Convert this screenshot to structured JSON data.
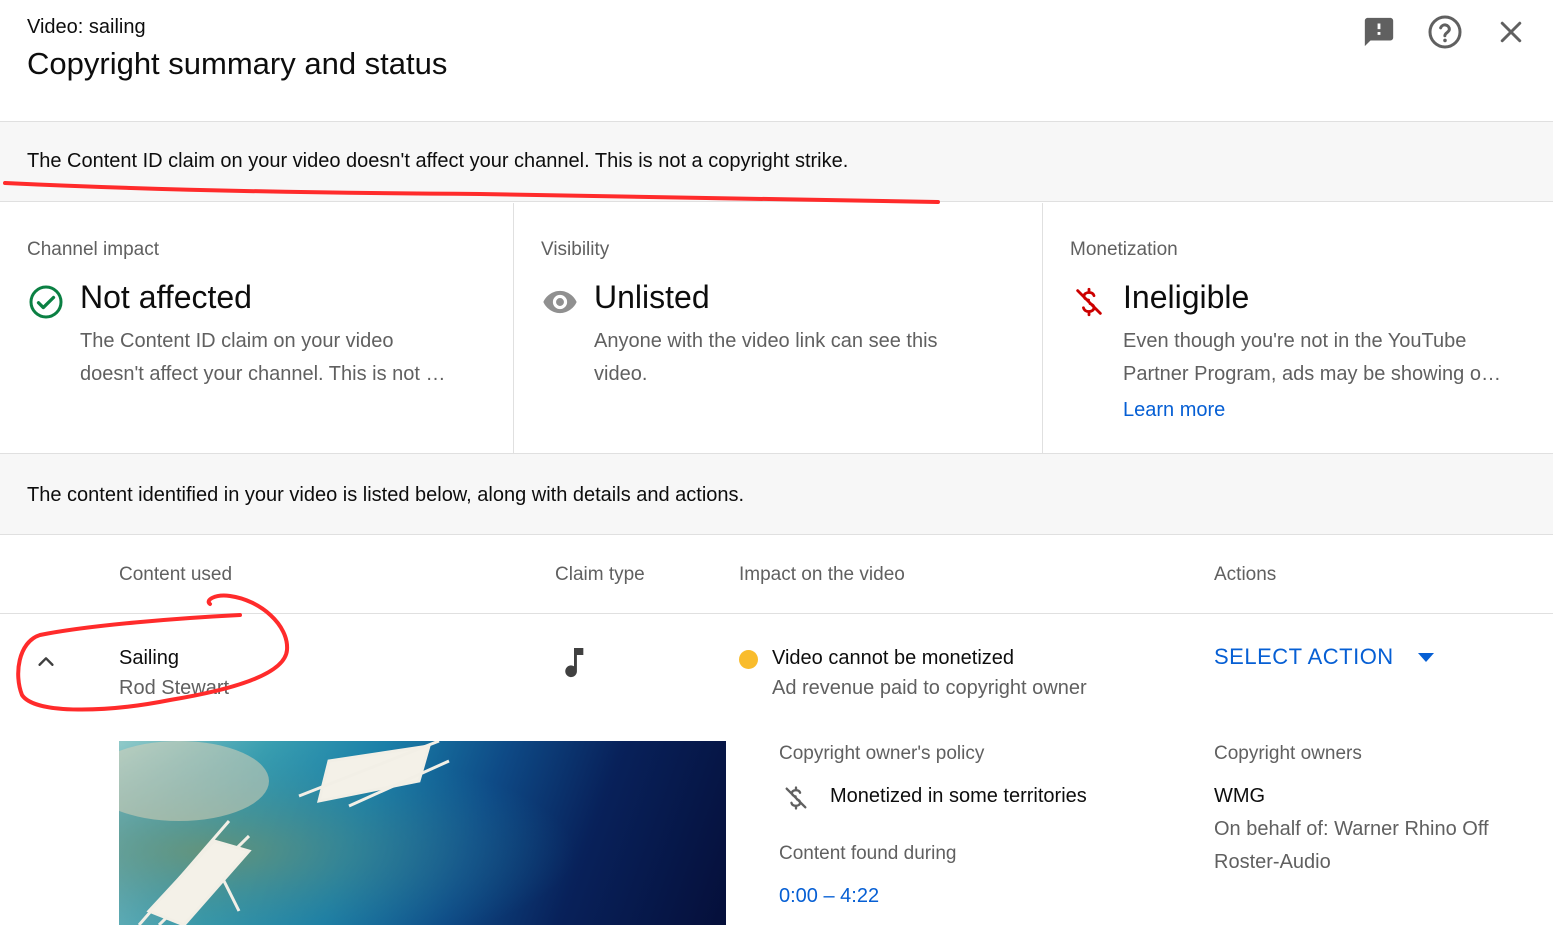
{
  "header": {
    "subtitle": "Video: sailing",
    "title": "Copyright summary and status",
    "icons": [
      "feedback-icon",
      "help-icon",
      "close-icon"
    ]
  },
  "banner": {
    "text": "The Content ID claim on your video doesn't affect your channel. This is not a copyright strike."
  },
  "cards": [
    {
      "label": "Channel impact",
      "value": "Not affected",
      "desc_line1": "The Content ID claim on your video",
      "desc_line2": "doesn't affect your channel. This is not …",
      "icon": "check-circle-icon",
      "icon_color": "#0b8043"
    },
    {
      "label": "Visibility",
      "value": "Unlisted",
      "desc_line1": "Anyone with the video link can see this",
      "desc_line2": "video.",
      "icon": "eye-icon",
      "icon_color": "#909090"
    },
    {
      "label": "Monetization",
      "value": "Ineligible",
      "desc_line1": "Even though you're not in the YouTube",
      "desc_line2": "Partner Program, ads may be showing o…",
      "link": "Learn more",
      "icon": "no-money-icon",
      "icon_color": "#cc0000"
    }
  ],
  "listed_text": "The content identified in your video is listed below, along with details and actions.",
  "table": {
    "headers": {
      "content_used": "Content used",
      "claim_type": "Claim type",
      "impact": "Impact on the video",
      "actions": "Actions"
    },
    "row": {
      "title": "Sailing",
      "artist": "Rod Stewart",
      "claim_icon": "music-note-icon",
      "impact_title": "Video cannot be monetized",
      "impact_sub": "Ad revenue paid to copyright owner",
      "action_label": "SELECT ACTION",
      "status_color": "#f9bc2c"
    },
    "details": {
      "policy_label": "Copyright owner's policy",
      "policy_value": "Monetized in some territories",
      "found_label": "Content found during",
      "found_value": "0:00 – 4:22",
      "owners_label": "Copyright owners",
      "owner_name": "WMG",
      "owner_line1": "On behalf of: Warner Rhino Off",
      "owner_line2": "Roster-Audio"
    }
  },
  "colors": {
    "accent": "#065fd4",
    "annotation": "#ff2b2b"
  }
}
